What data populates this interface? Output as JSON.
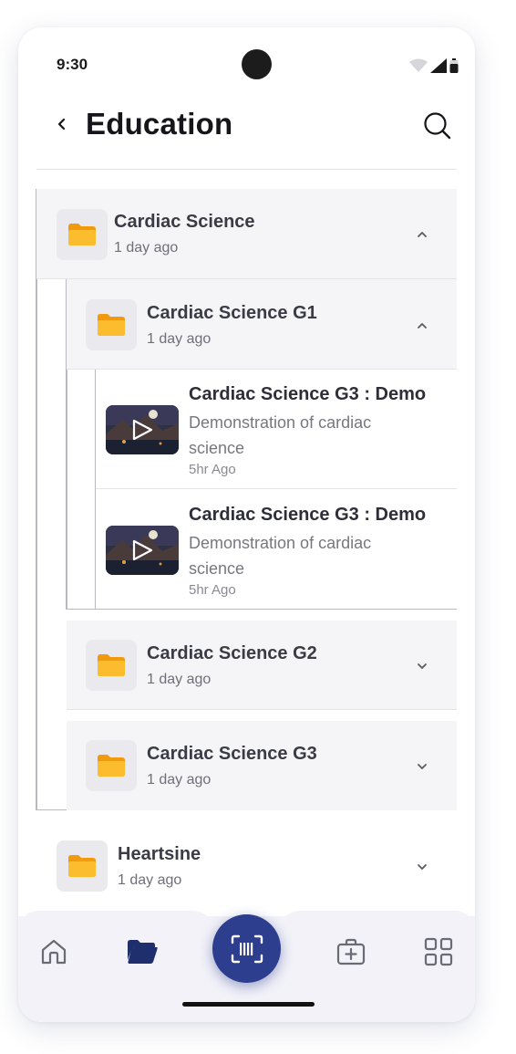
{
  "status_bar": {
    "time": "9:30"
  },
  "header": {
    "title": "Education"
  },
  "tree": {
    "root": {
      "title": "Cardiac Science",
      "subtitle": "1 day ago"
    },
    "g1": {
      "title": "Cardiac Science G1",
      "subtitle": "1 day ago"
    },
    "videos": [
      {
        "title": "Cardiac Science G3 : Demo",
        "description": "Demonstration of cardiac science",
        "time": "5hr Ago"
      },
      {
        "title": "Cardiac Science G3 : Demo",
        "description": "Demonstration of cardiac science",
        "time": "5hr Ago"
      }
    ],
    "g2": {
      "title": "Cardiac Science G2",
      "subtitle": "1 day ago"
    },
    "g3": {
      "title": "Cardiac Science G3",
      "subtitle": "1 day ago"
    },
    "heartsine": {
      "title": "Heartsine",
      "subtitle": "1 day ago"
    }
  },
  "bottom_nav": {
    "items": [
      "home-icon",
      "folder-icon",
      "barcode-scan-icon",
      "first-aid-kit-icon",
      "grid-icon"
    ],
    "active": "folder-icon"
  },
  "colors": {
    "accent": "#2d3e8e",
    "folder": "#f7a814",
    "row_bg": "#f5f5f7"
  }
}
